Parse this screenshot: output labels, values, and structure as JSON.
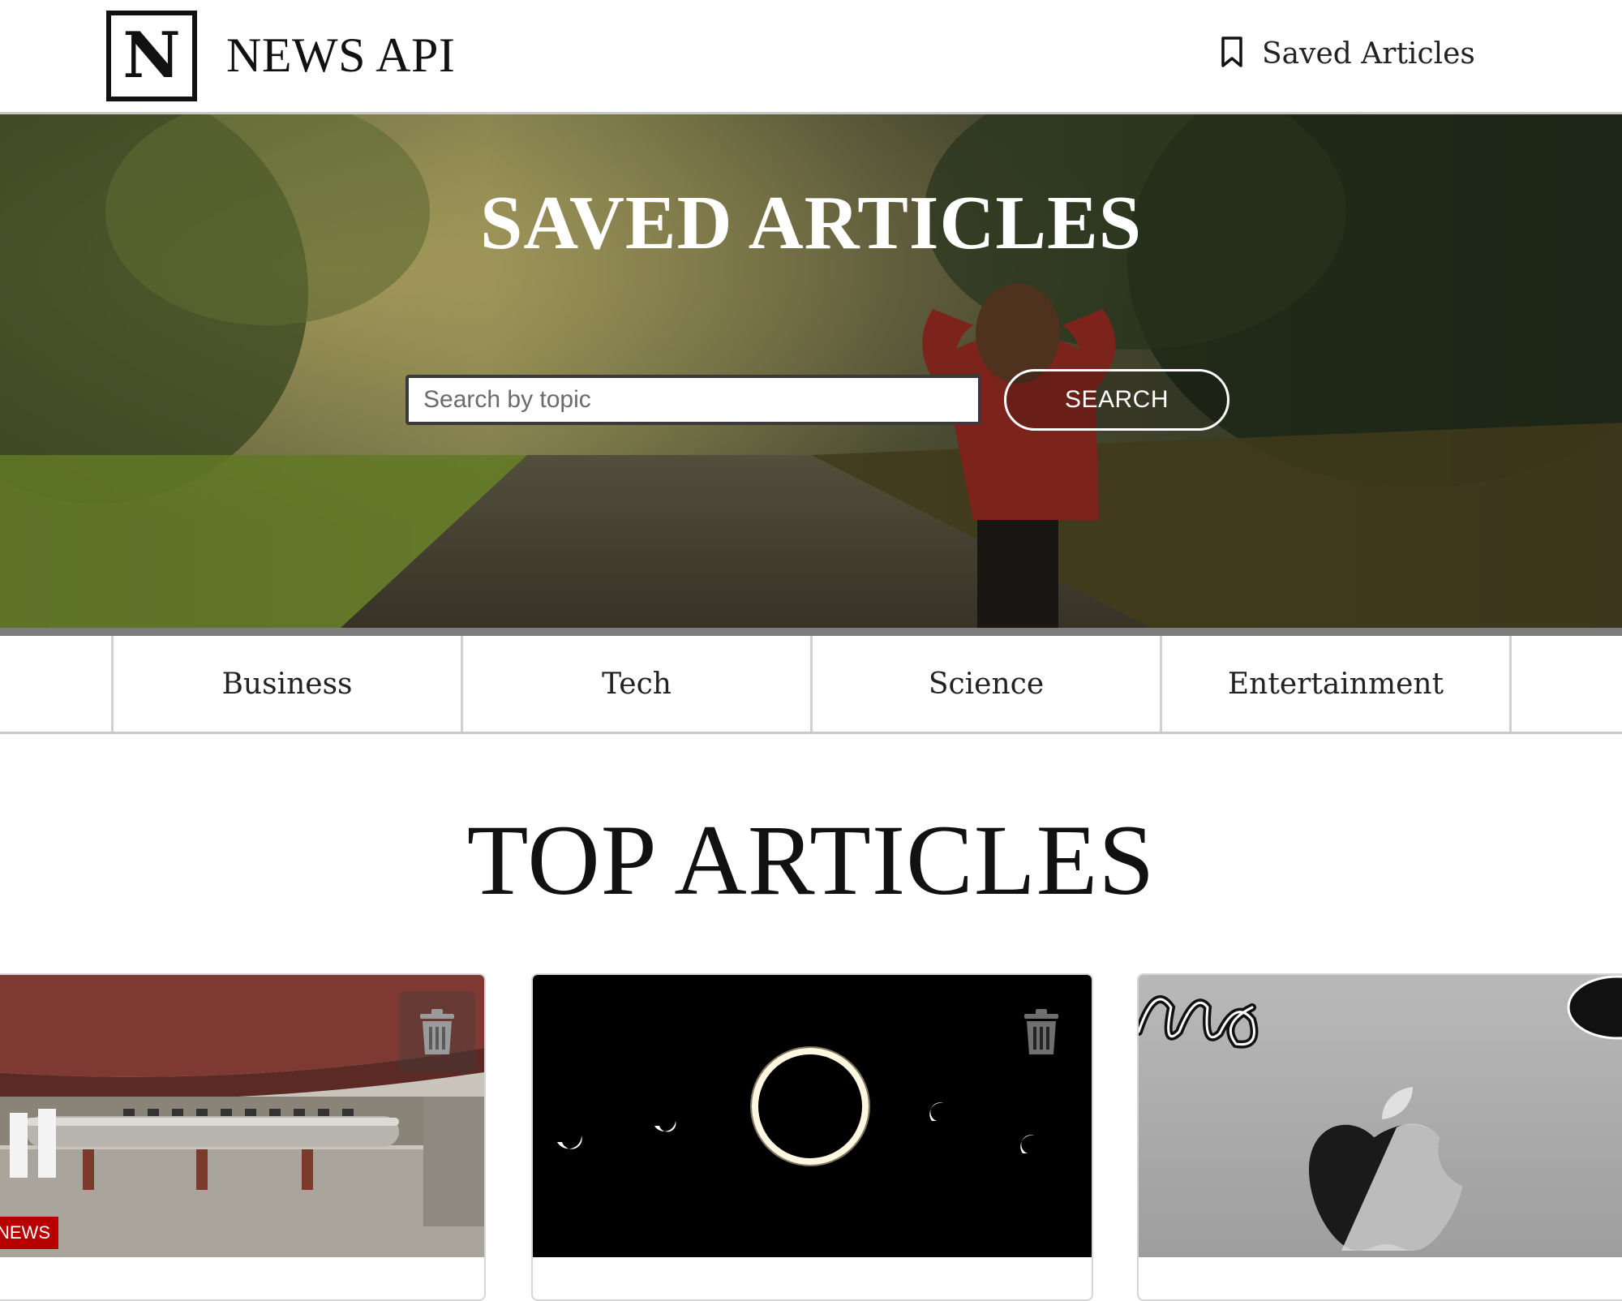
{
  "header": {
    "logo_letter": "N",
    "brand": "NEWS API",
    "saved_link_label": "Saved Articles"
  },
  "hero": {
    "title": "SAVED ARTICLES",
    "search_placeholder": "Search by topic",
    "search_button": "SEARCH"
  },
  "categories": [
    "Business",
    "Tech",
    "Science",
    "Entertainment"
  ],
  "section_title": "TOP ARTICLES",
  "cards": [
    {
      "badge": "NEWS",
      "icon": "trash-icon"
    },
    {
      "icon": "trash-icon"
    },
    {}
  ],
  "colors": {
    "accent": "#111111",
    "badge_red": "#b80000",
    "divider": "#c8c8c8"
  }
}
